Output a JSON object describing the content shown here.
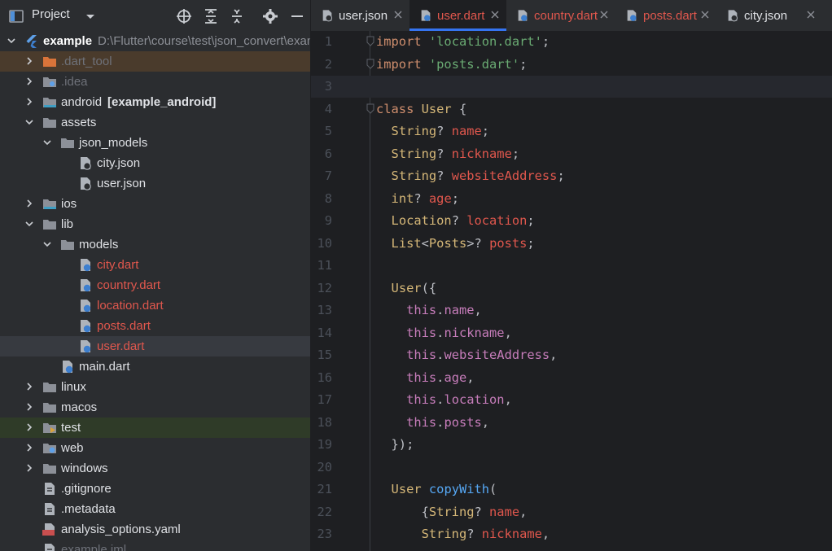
{
  "panel": {
    "title": "Project"
  },
  "tree": [
    {
      "label": "example",
      "extra": "D:\\Flutter\\course\\test\\json_convert\\exam",
      "bold": true
    },
    {
      "label": ".dart_tool",
      "dim": true
    },
    {
      "label": ".idea",
      "dim": true
    },
    {
      "label": "android",
      "extra": "[example_android]"
    },
    {
      "label": "assets"
    },
    {
      "label": "json_models"
    },
    {
      "label": "city.json"
    },
    {
      "label": "user.json"
    },
    {
      "label": "ios"
    },
    {
      "label": "lib"
    },
    {
      "label": "models"
    },
    {
      "label": "city.dart",
      "modified": true
    },
    {
      "label": "country.dart",
      "modified": true
    },
    {
      "label": "location.dart",
      "modified": true
    },
    {
      "label": "posts.dart",
      "modified": true
    },
    {
      "label": "user.dart",
      "modified": true
    },
    {
      "label": "main.dart"
    },
    {
      "label": "linux"
    },
    {
      "label": "macos"
    },
    {
      "label": "test"
    },
    {
      "label": "web"
    },
    {
      "label": "windows"
    },
    {
      "label": ".gitignore"
    },
    {
      "label": ".metadata"
    },
    {
      "label": "analysis_options.yaml"
    },
    {
      "label": "example.iml",
      "dim": true
    }
  ],
  "tabs": [
    {
      "label": "user.json"
    },
    {
      "label": "user.dart",
      "active": true,
      "modified": true
    },
    {
      "label": "country.dart",
      "modified": true
    },
    {
      "label": "posts.dart",
      "modified": true
    },
    {
      "label": "city.json"
    }
  ],
  "code": {
    "line_numbers": [
      "1",
      "2",
      "3",
      "4",
      "5",
      "6",
      "7",
      "8",
      "9",
      "10",
      "11",
      "12",
      "13",
      "14",
      "15",
      "16",
      "17",
      "18",
      "19",
      "20",
      "21",
      "22",
      "23"
    ],
    "current_line": 3,
    "lines": [
      [
        [
          "kw",
          "import"
        ],
        [
          "punc",
          " "
        ],
        [
          "str",
          "'location.dart'"
        ],
        [
          "punc",
          ";"
        ]
      ],
      [
        [
          "kw",
          "import"
        ],
        [
          "punc",
          " "
        ],
        [
          "str",
          "'posts.dart'"
        ],
        [
          "punc",
          ";"
        ]
      ],
      [],
      [
        [
          "kw",
          "class"
        ],
        [
          "punc",
          " "
        ],
        [
          "type",
          "User"
        ],
        [
          "punc",
          " {"
        ]
      ],
      [
        [
          "punc",
          "  "
        ],
        [
          "type",
          "String"
        ],
        [
          "punc",
          "? "
        ],
        [
          "field2",
          "name"
        ],
        [
          "punc",
          ";"
        ]
      ],
      [
        [
          "punc",
          "  "
        ],
        [
          "type",
          "String"
        ],
        [
          "punc",
          "? "
        ],
        [
          "field2",
          "nickname"
        ],
        [
          "punc",
          ";"
        ]
      ],
      [
        [
          "punc",
          "  "
        ],
        [
          "type",
          "String"
        ],
        [
          "punc",
          "? "
        ],
        [
          "field2",
          "websiteAddress"
        ],
        [
          "punc",
          ";"
        ]
      ],
      [
        [
          "punc",
          "  "
        ],
        [
          "type",
          "int"
        ],
        [
          "punc",
          "? "
        ],
        [
          "field2",
          "age"
        ],
        [
          "punc",
          ";"
        ]
      ],
      [
        [
          "punc",
          "  "
        ],
        [
          "type",
          "Location"
        ],
        [
          "punc",
          "? "
        ],
        [
          "field2",
          "location"
        ],
        [
          "punc",
          ";"
        ]
      ],
      [
        [
          "punc",
          "  "
        ],
        [
          "type",
          "List"
        ],
        [
          "punc",
          "<"
        ],
        [
          "type",
          "Posts"
        ],
        [
          "punc",
          ">? "
        ],
        [
          "field2",
          "posts"
        ],
        [
          "punc",
          ";"
        ]
      ],
      [],
      [
        [
          "punc",
          "  "
        ],
        [
          "type",
          "User"
        ],
        [
          "punc",
          "({"
        ]
      ],
      [
        [
          "punc",
          "    "
        ],
        [
          "this",
          "this"
        ],
        [
          "punc",
          "."
        ],
        [
          "field",
          "name"
        ],
        [
          "punc",
          ","
        ]
      ],
      [
        [
          "punc",
          "    "
        ],
        [
          "this",
          "this"
        ],
        [
          "punc",
          "."
        ],
        [
          "field",
          "nickname"
        ],
        [
          "punc",
          ","
        ]
      ],
      [
        [
          "punc",
          "    "
        ],
        [
          "this",
          "this"
        ],
        [
          "punc",
          "."
        ],
        [
          "field",
          "websiteAddress"
        ],
        [
          "punc",
          ","
        ]
      ],
      [
        [
          "punc",
          "    "
        ],
        [
          "this",
          "this"
        ],
        [
          "punc",
          "."
        ],
        [
          "field",
          "age"
        ],
        [
          "punc",
          ","
        ]
      ],
      [
        [
          "punc",
          "    "
        ],
        [
          "this",
          "this"
        ],
        [
          "punc",
          "."
        ],
        [
          "field",
          "location"
        ],
        [
          "punc",
          ","
        ]
      ],
      [
        [
          "punc",
          "    "
        ],
        [
          "this",
          "this"
        ],
        [
          "punc",
          "."
        ],
        [
          "field",
          "posts"
        ],
        [
          "punc",
          ","
        ]
      ],
      [
        [
          "punc",
          "  });"
        ]
      ],
      [],
      [
        [
          "punc",
          "  "
        ],
        [
          "type",
          "User"
        ],
        [
          "punc",
          " "
        ],
        [
          "fn",
          "copyWith"
        ],
        [
          "punc",
          "("
        ]
      ],
      [
        [
          "punc",
          "      {"
        ],
        [
          "type",
          "String"
        ],
        [
          "punc",
          "? "
        ],
        [
          "field2",
          "name"
        ],
        [
          "punc",
          ","
        ]
      ],
      [
        [
          "punc",
          "      "
        ],
        [
          "type",
          "String"
        ],
        [
          "punc",
          "? "
        ],
        [
          "field2",
          "nickname"
        ],
        [
          "punc",
          ","
        ]
      ]
    ]
  }
}
